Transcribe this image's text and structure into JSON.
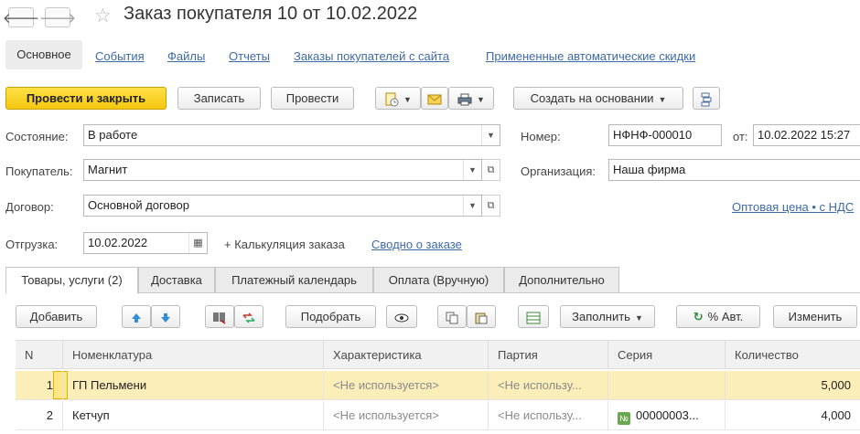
{
  "window": {
    "title": "Заказ покупателя 10 от 10.02.2022"
  },
  "nav": {
    "back_icon": "arrow-left-icon",
    "forward_icon": "arrow-right-icon",
    "favorite_icon": "star-icon"
  },
  "sections": {
    "main": "Основное",
    "links": [
      "События",
      "Файлы",
      "Отчеты",
      "Заказы покупателей с сайта",
      "Примененные автоматические скидки"
    ]
  },
  "toolbar": {
    "post_close": "Провести и закрыть",
    "save": "Записать",
    "post": "Провести",
    "create_based": "Создать на основании"
  },
  "form": {
    "status_label": "Состояние:",
    "status_value": "В работе",
    "buyer_label": "Покупатель:",
    "buyer_value": "Магнит",
    "contract_label": "Договор:",
    "contract_value": "Основной договор",
    "shipment_label": "Отгрузка:",
    "shipment_value": "10.02.2022",
    "calc_label": "+ Калькуляция заказа",
    "summary_link": "Сводно о заказе",
    "number_label": "Номер:",
    "number_value": "НФНФ-000010",
    "from_label": "от:",
    "from_value": "10.02.2022 15:27",
    "org_label": "Организация:",
    "org_value": "Наша фирма",
    "price_link": "Оптовая цена • с НДС"
  },
  "tabs": [
    {
      "label": "Товары, услуги (2)"
    },
    {
      "label": "Доставка"
    },
    {
      "label": "Платежный календарь"
    },
    {
      "label": "Оплата (Вручную)"
    },
    {
      "label": "Дополнительно"
    }
  ],
  "table_toolbar": {
    "add": "Добавить",
    "select": "Подобрать",
    "fill": "Заполнить",
    "auto_discount": "% Авт.",
    "change": "Изменить"
  },
  "table": {
    "columns": [
      "N",
      "Номенклатура",
      "Характеристика",
      "Партия",
      "Серия",
      "Количество"
    ],
    "rows": [
      {
        "n": "1",
        "item": "ГП Пельмени",
        "char": "<Не используется>",
        "batch": "<Не использу...",
        "series": "",
        "qty": "5,000"
      },
      {
        "n": "2",
        "item": "Кетчуп",
        "char": "<Не используется>",
        "batch": "<Не использу...",
        "series": "00000003...",
        "qty": "4,000"
      }
    ]
  },
  "colors": {
    "accent_yellow": "#f4c711",
    "link_blue": "#3d6aa8",
    "selected_row": "#fbeeb8"
  }
}
